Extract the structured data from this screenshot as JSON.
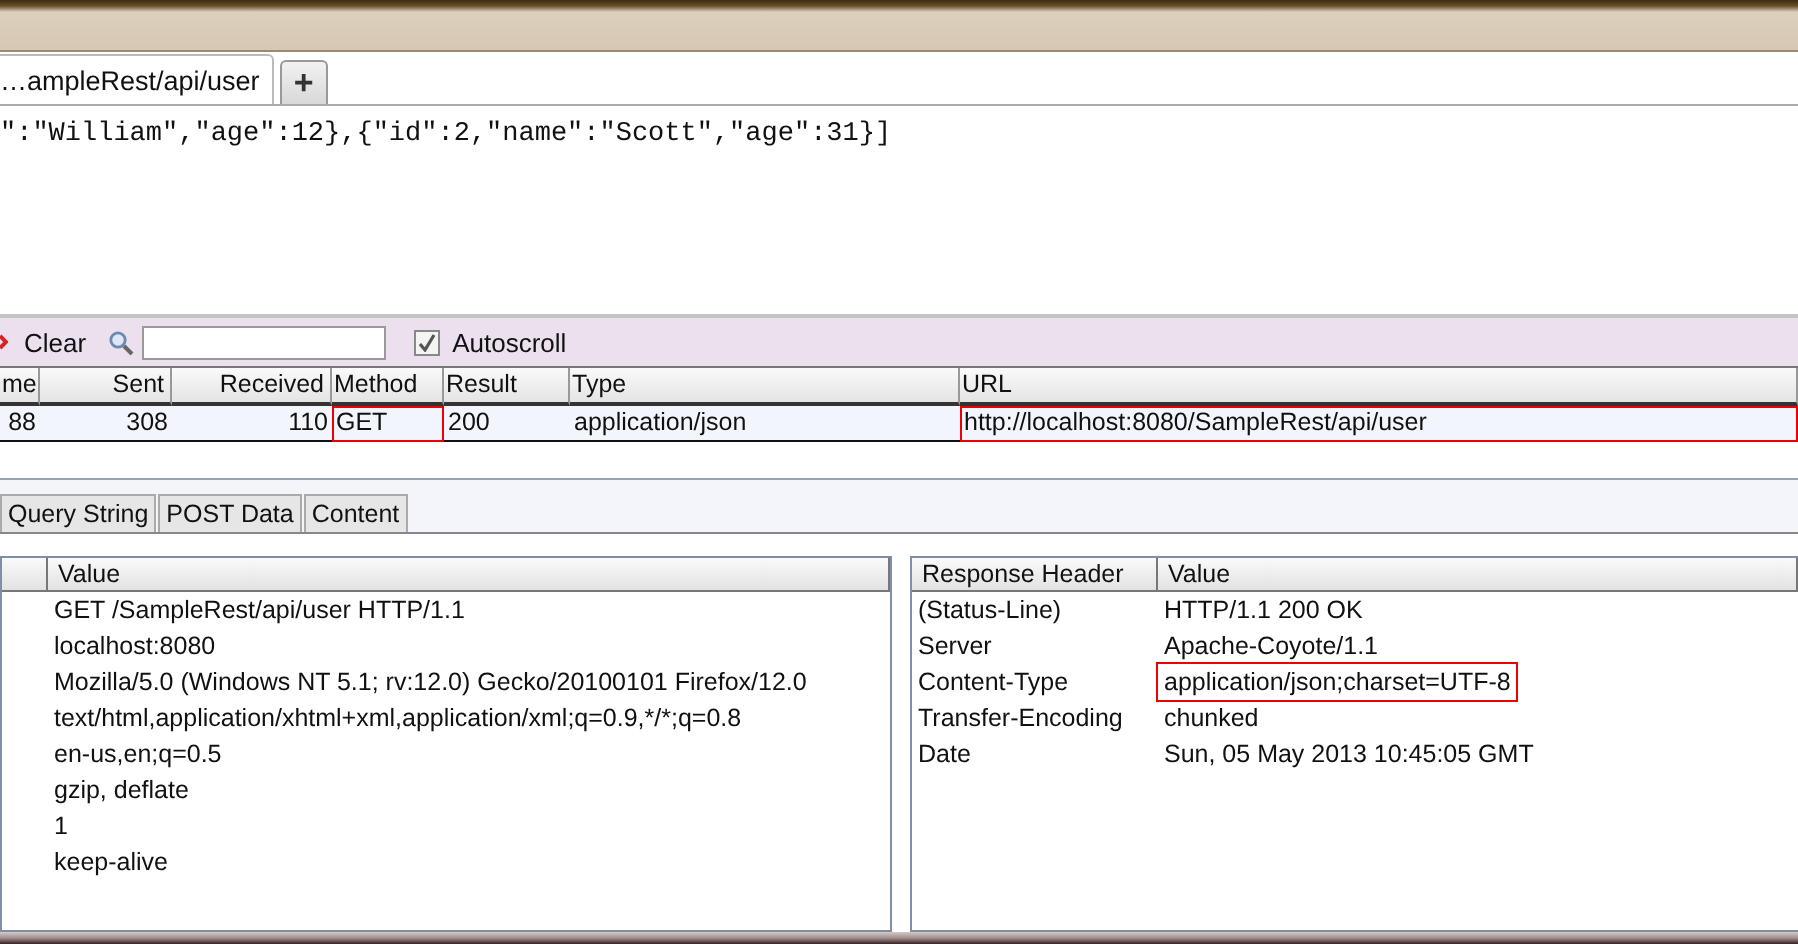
{
  "tab": {
    "title": "…ampleRest/api/user",
    "new_tab": "+"
  },
  "response_body": "\":\"William\",\"age\":12},{\"id\":2,\"name\":\"Scott\",\"age\":31}]",
  "toolbar": {
    "clear": "Clear",
    "autoscroll": {
      "label": "Autoscroll",
      "checked": true
    }
  },
  "requests": {
    "columns": [
      "me",
      "Sent",
      "Received",
      "Method",
      "Result",
      "Type",
      "URL"
    ],
    "rows": [
      [
        {
          "text": "88",
          "highlighted": false
        },
        {
          "text": "308",
          "highlighted": false
        },
        {
          "text": "110",
          "highlighted": false
        },
        {
          "text": "GET",
          "highlighted": true
        },
        {
          "text": "200",
          "highlighted": false
        },
        {
          "text": "application/json",
          "highlighted": false
        },
        {
          "text": "http://localhost:8080/SampleRest/api/user",
          "highlighted": true
        }
      ]
    ]
  },
  "detail_tabs": [
    {
      "label": "Query String",
      "selected": false
    },
    {
      "label": "POST Data",
      "selected": false
    },
    {
      "label": "Content",
      "selected": false
    }
  ],
  "request_headers": {
    "columns": [
      "",
      "Value"
    ],
    "rows": [
      {
        "value": "GET /SampleRest/api/user HTTP/1.1"
      },
      {
        "value": "localhost:8080"
      },
      {
        "value": "Mozilla/5.0 (Windows NT 5.1; rv:12.0) Gecko/20100101 Firefox/12.0"
      },
      {
        "value": "text/html,application/xhtml+xml,application/xml;q=0.9,*/*;q=0.8"
      },
      {
        "value": "en-us,en;q=0.5"
      },
      {
        "value": "gzip, deflate"
      },
      {
        "value": "1"
      },
      {
        "value": "keep-alive"
      }
    ]
  },
  "response_headers": {
    "columns": [
      "Response Header",
      "Value"
    ],
    "rows": [
      {
        "name": "(Status-Line)",
        "value": "HTTP/1.1 200 OK",
        "highlighted": false
      },
      {
        "name": "Server",
        "value": "Apache-Coyote/1.1",
        "highlighted": false
      },
      {
        "name": "Content-Type",
        "value": "application/json;charset=UTF-8",
        "highlighted": true
      },
      {
        "name": "Transfer-Encoding",
        "value": "chunked",
        "highlighted": false
      },
      {
        "name": "Date",
        "value": "Sun, 05 May 2013 10:45:05 GMT",
        "highlighted": false
      }
    ]
  }
}
